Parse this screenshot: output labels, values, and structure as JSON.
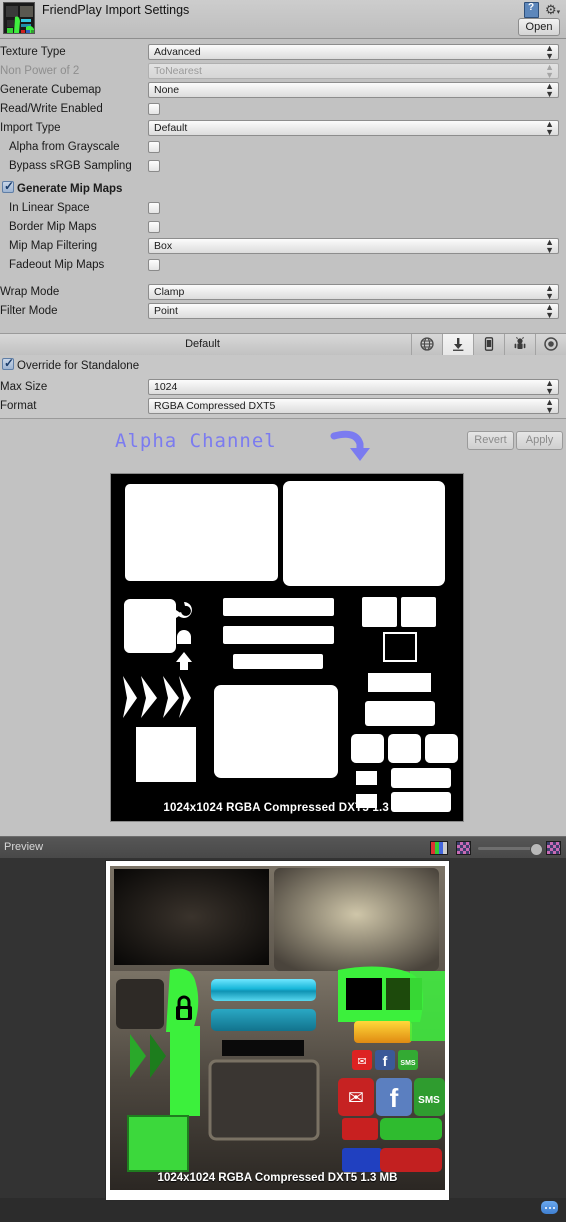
{
  "header": {
    "title": "FriendPlay Import Settings",
    "open_label": "Open",
    "help_icon": "help-book-icon",
    "gear_icon": "gear-icon",
    "thumbnail_icon": "texture-thumbnail"
  },
  "settings": [
    {
      "label": "Texture Type",
      "type": "dropdown",
      "value": "Advanced",
      "indent": false,
      "disabled": false
    },
    {
      "label": "Non Power of 2",
      "type": "dropdown",
      "value": "ToNearest",
      "indent": false,
      "disabled": true
    },
    {
      "label": "Generate Cubemap",
      "type": "dropdown",
      "value": "None",
      "indent": false,
      "disabled": false
    },
    {
      "label": "Read/Write Enabled",
      "type": "checkbox",
      "checked": false,
      "indent": false,
      "disabled": false
    },
    {
      "label": "Import Type",
      "type": "dropdown",
      "value": "Default",
      "indent": false,
      "disabled": false
    },
    {
      "label": "Alpha from Grayscale",
      "type": "checkbox",
      "checked": false,
      "indent": true,
      "disabled": false
    },
    {
      "label": "Bypass sRGB Sampling",
      "type": "checkbox",
      "checked": false,
      "indent": true,
      "disabled": false
    },
    {
      "label": "Generate Mip Maps",
      "type": "checkbox-left",
      "checked": true,
      "indent": false,
      "disabled": false,
      "bold": true
    },
    {
      "label": "In Linear Space",
      "type": "checkbox",
      "checked": false,
      "indent": true,
      "disabled": false
    },
    {
      "label": "Border Mip Maps",
      "type": "checkbox",
      "checked": false,
      "indent": true,
      "disabled": false
    },
    {
      "label": "Mip Map Filtering",
      "type": "dropdown",
      "value": "Box",
      "indent": true,
      "disabled": false
    },
    {
      "label": "Fadeout Mip Maps",
      "type": "checkbox",
      "checked": false,
      "indent": true,
      "disabled": false
    },
    {
      "label": "Wrap Mode",
      "type": "dropdown",
      "value": "Clamp",
      "indent": false,
      "disabled": false
    },
    {
      "label": "Filter Mode",
      "type": "dropdown",
      "value": "Point",
      "indent": false,
      "disabled": false
    }
  ],
  "platform": {
    "default_label": "Default",
    "tabs": [
      {
        "name": "web-platform-tab",
        "icon": "globe-icon",
        "selected": false
      },
      {
        "name": "standalone-platform-tab",
        "icon": "download-icon",
        "selected": true
      },
      {
        "name": "ios-platform-tab",
        "icon": "iphone-icon",
        "selected": false
      },
      {
        "name": "android-platform-tab",
        "icon": "android-robot-icon",
        "selected": false
      },
      {
        "name": "flash-platform-tab",
        "icon": "circle-icon",
        "selected": false
      }
    ],
    "override_label": "Override for Standalone",
    "override_checked": true,
    "max_size_label": "Max Size",
    "max_size_value": "1024",
    "format_label": "Format",
    "format_value": "RGBA Compressed DXT5"
  },
  "annotation": {
    "text": "Alpha Channel",
    "color": "#7b7bf0",
    "arrow_icon": "curved-down-arrow-icon"
  },
  "buttons": {
    "revert_label": "Revert",
    "apply_label": "Apply"
  },
  "alpha_preview": {
    "caption": "1024x1024  RGBA Compressed DXT5   1.3 MB"
  },
  "preview": {
    "title": "Preview",
    "rgb_swatch_icon": "rgb-channels-icon",
    "checker_left_icon": "checkerboard-icon",
    "checker_right_icon": "checkerboard-icon",
    "slider_value": 88,
    "caption": "1024x1024  RGBA Compressed DXT5   1.3 MB"
  },
  "status": {
    "badge_icon": "notification-badge-icon"
  }
}
